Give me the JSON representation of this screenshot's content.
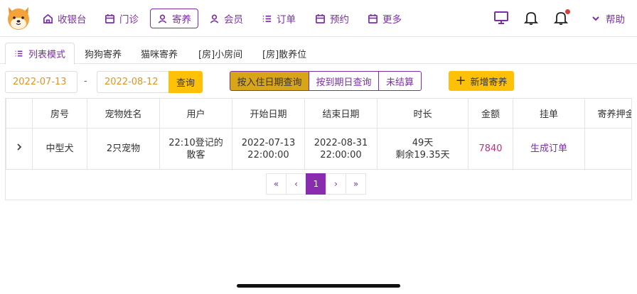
{
  "nav": {
    "items": [
      {
        "label": "收银台",
        "icon": "home-icon"
      },
      {
        "label": "门诊",
        "icon": "calendar-icon"
      },
      {
        "label": "寄养",
        "icon": "user-icon",
        "active": true
      },
      {
        "label": "会员",
        "icon": "user-icon"
      },
      {
        "label": "订单",
        "icon": "list-icon"
      },
      {
        "label": "预约",
        "icon": "calendar-icon"
      },
      {
        "label": "更多",
        "icon": "calendar-icon"
      }
    ],
    "help_label": "帮助",
    "accent_color": "#7b2fa6"
  },
  "subtabs": [
    {
      "label": "列表模式",
      "active": true
    },
    {
      "label": "狗狗寄养"
    },
    {
      "label": "猫咪寄养"
    },
    {
      "label": "[房]小房间"
    },
    {
      "label": "[房]散养位"
    }
  ],
  "filter": {
    "start_date": "2022-07-13",
    "separator": "-",
    "end_date": "2022-08-12",
    "query_label": "查询",
    "segments": [
      "按入住日期查询",
      "按到期日查询",
      "未结算"
    ],
    "active_segment": 0,
    "add_label": "新增寄养"
  },
  "table": {
    "headers": [
      "",
      "房号",
      "宠物姓名",
      "用户",
      "开始日期",
      "结束日期",
      "时长",
      "金额",
      "挂单",
      "寄养押金"
    ],
    "rows": [
      {
        "room": "中型犬",
        "pet": "2只宠物",
        "user_line1": "22:10登记的",
        "user_line2": "散客",
        "start_date": "2022-07-13",
        "start_time": "22:00:00",
        "end_date": "2022-08-31",
        "end_time": "22:00:00",
        "duration": "49天",
        "remaining": "剩余19.35天",
        "amount": "7840",
        "pending": "生成订单"
      }
    ]
  },
  "pagination": {
    "first": "«",
    "prev": "‹",
    "current": "1",
    "next": "›",
    "last": "»"
  }
}
